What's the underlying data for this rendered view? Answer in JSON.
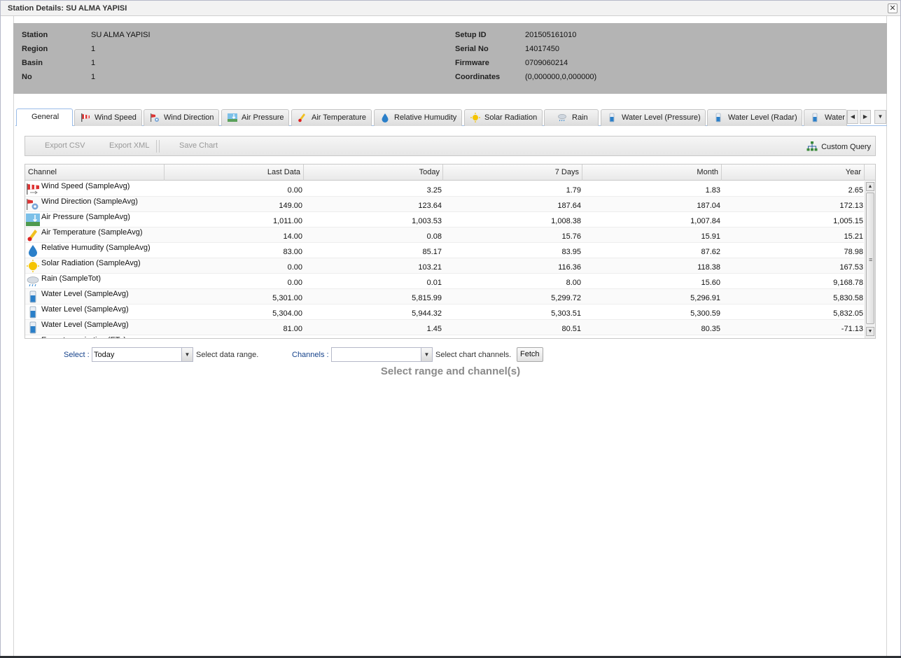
{
  "window": {
    "title": "Station Details: SU ALMA YAPISI"
  },
  "info": {
    "left": [
      {
        "label": "Station",
        "value": "SU ALMA YAPISI"
      },
      {
        "label": "Region",
        "value": "1"
      },
      {
        "label": "Basin",
        "value": "1"
      },
      {
        "label": "No",
        "value": "1"
      }
    ],
    "right": [
      {
        "label": "Setup ID",
        "value": "201505161010"
      },
      {
        "label": "Serial No",
        "value": "14017450"
      },
      {
        "label": "Firmware",
        "value": "0709060214"
      },
      {
        "label": "Coordinates",
        "value": "(0,000000,0,000000)"
      }
    ]
  },
  "tabs": [
    {
      "label": "General",
      "icon": "none",
      "active": true
    },
    {
      "label": "Wind Speed",
      "icon": "windsock-icon",
      "active": false
    },
    {
      "label": "Wind Direction",
      "icon": "wind-direction-icon",
      "active": false
    },
    {
      "label": "Air Pressure",
      "icon": "air-pressure-icon",
      "active": false
    },
    {
      "label": "Air Temperature",
      "icon": "thermometer-icon",
      "active": false
    },
    {
      "label": "Relative Humudity",
      "icon": "water-drop-icon",
      "active": false
    },
    {
      "label": "Solar Radiation",
      "icon": "sun-icon",
      "active": false
    },
    {
      "label": "Rain",
      "icon": "rain-cloud-icon",
      "active": false
    },
    {
      "label": "Water Level (Pressure)",
      "icon": "water-level-icon",
      "active": false
    },
    {
      "label": "Water Level (Radar)",
      "icon": "water-level-icon",
      "active": false
    },
    {
      "label": "Water",
      "icon": "water-level-icon",
      "active": false
    }
  ],
  "toolbar": {
    "export_csv": "Export CSV",
    "export_xml": "Export XML",
    "save_chart": "Save Chart",
    "custom_query": "Custom Query"
  },
  "grid": {
    "columns": [
      "Channel",
      "Last Data",
      "Today",
      "7 Days",
      "Month",
      "Year"
    ],
    "rows": [
      {
        "channel": "Wind Speed (SampleAvg)",
        "icon": "windsock-icon",
        "last": "0.00",
        "today": "3.25",
        "days7": "1.79",
        "month": "1.83",
        "year": "2.65"
      },
      {
        "channel": "Wind Direction (SampleAvg)",
        "icon": "wind-direction-icon",
        "last": "149.00",
        "today": "123.64",
        "days7": "187.64",
        "month": "187.04",
        "year": "172.13"
      },
      {
        "channel": "Air Pressure (SampleAvg)",
        "icon": "air-pressure-icon",
        "last": "1,011.00",
        "today": "1,003.53",
        "days7": "1,008.38",
        "month": "1,007.84",
        "year": "1,005.15"
      },
      {
        "channel": "Air Temperature (SampleAvg)",
        "icon": "thermometer-icon",
        "last": "14.00",
        "today": "0.08",
        "days7": "15.76",
        "month": "15.91",
        "year": "15.21"
      },
      {
        "channel": "Relative Humudity (SampleAvg)",
        "icon": "water-drop-icon",
        "last": "83.00",
        "today": "85.17",
        "days7": "83.95",
        "month": "87.62",
        "year": "78.98"
      },
      {
        "channel": "Solar Radiation (SampleAvg)",
        "icon": "sun-icon",
        "last": "0.00",
        "today": "103.21",
        "days7": "116.36",
        "month": "118.38",
        "year": "167.53"
      },
      {
        "channel": "Rain (SampleTot)",
        "icon": "rain-cloud-icon",
        "last": "0.00",
        "today": "0.01",
        "days7": "8.00",
        "month": "15.60",
        "year": "9,168.78"
      },
      {
        "channel": "Water Level (SampleAvg)",
        "icon": "water-level-icon",
        "last": "5,301.00",
        "today": "5,815.99",
        "days7": "5,299.72",
        "month": "5,296.91",
        "year": "5,830.58"
      },
      {
        "channel": "Water Level (SampleAvg)",
        "icon": "water-level-icon",
        "last": "5,304.00",
        "today": "5,944.32",
        "days7": "5,303.51",
        "month": "5,300.59",
        "year": "5,832.05"
      },
      {
        "channel": "Water Level (SampleAvg)",
        "icon": "water-level-icon",
        "last": "81.00",
        "today": "1.45",
        "days7": "80.51",
        "month": "80.35",
        "year": "-71.13"
      },
      {
        "channel": "Evapotranspiration (ETo)",
        "icon": "none",
        "last": "",
        "today": "",
        "days7": "",
        "month": "",
        "year": ""
      }
    ]
  },
  "controls": {
    "select_label": "Select :",
    "select_value": "Today",
    "select_hint": "Select data range.",
    "channels_label": "Channels :",
    "channels_value": "",
    "channels_hint": "Select chart channels.",
    "fetch": "Fetch"
  },
  "placeholder": "Select range and channel(s)"
}
